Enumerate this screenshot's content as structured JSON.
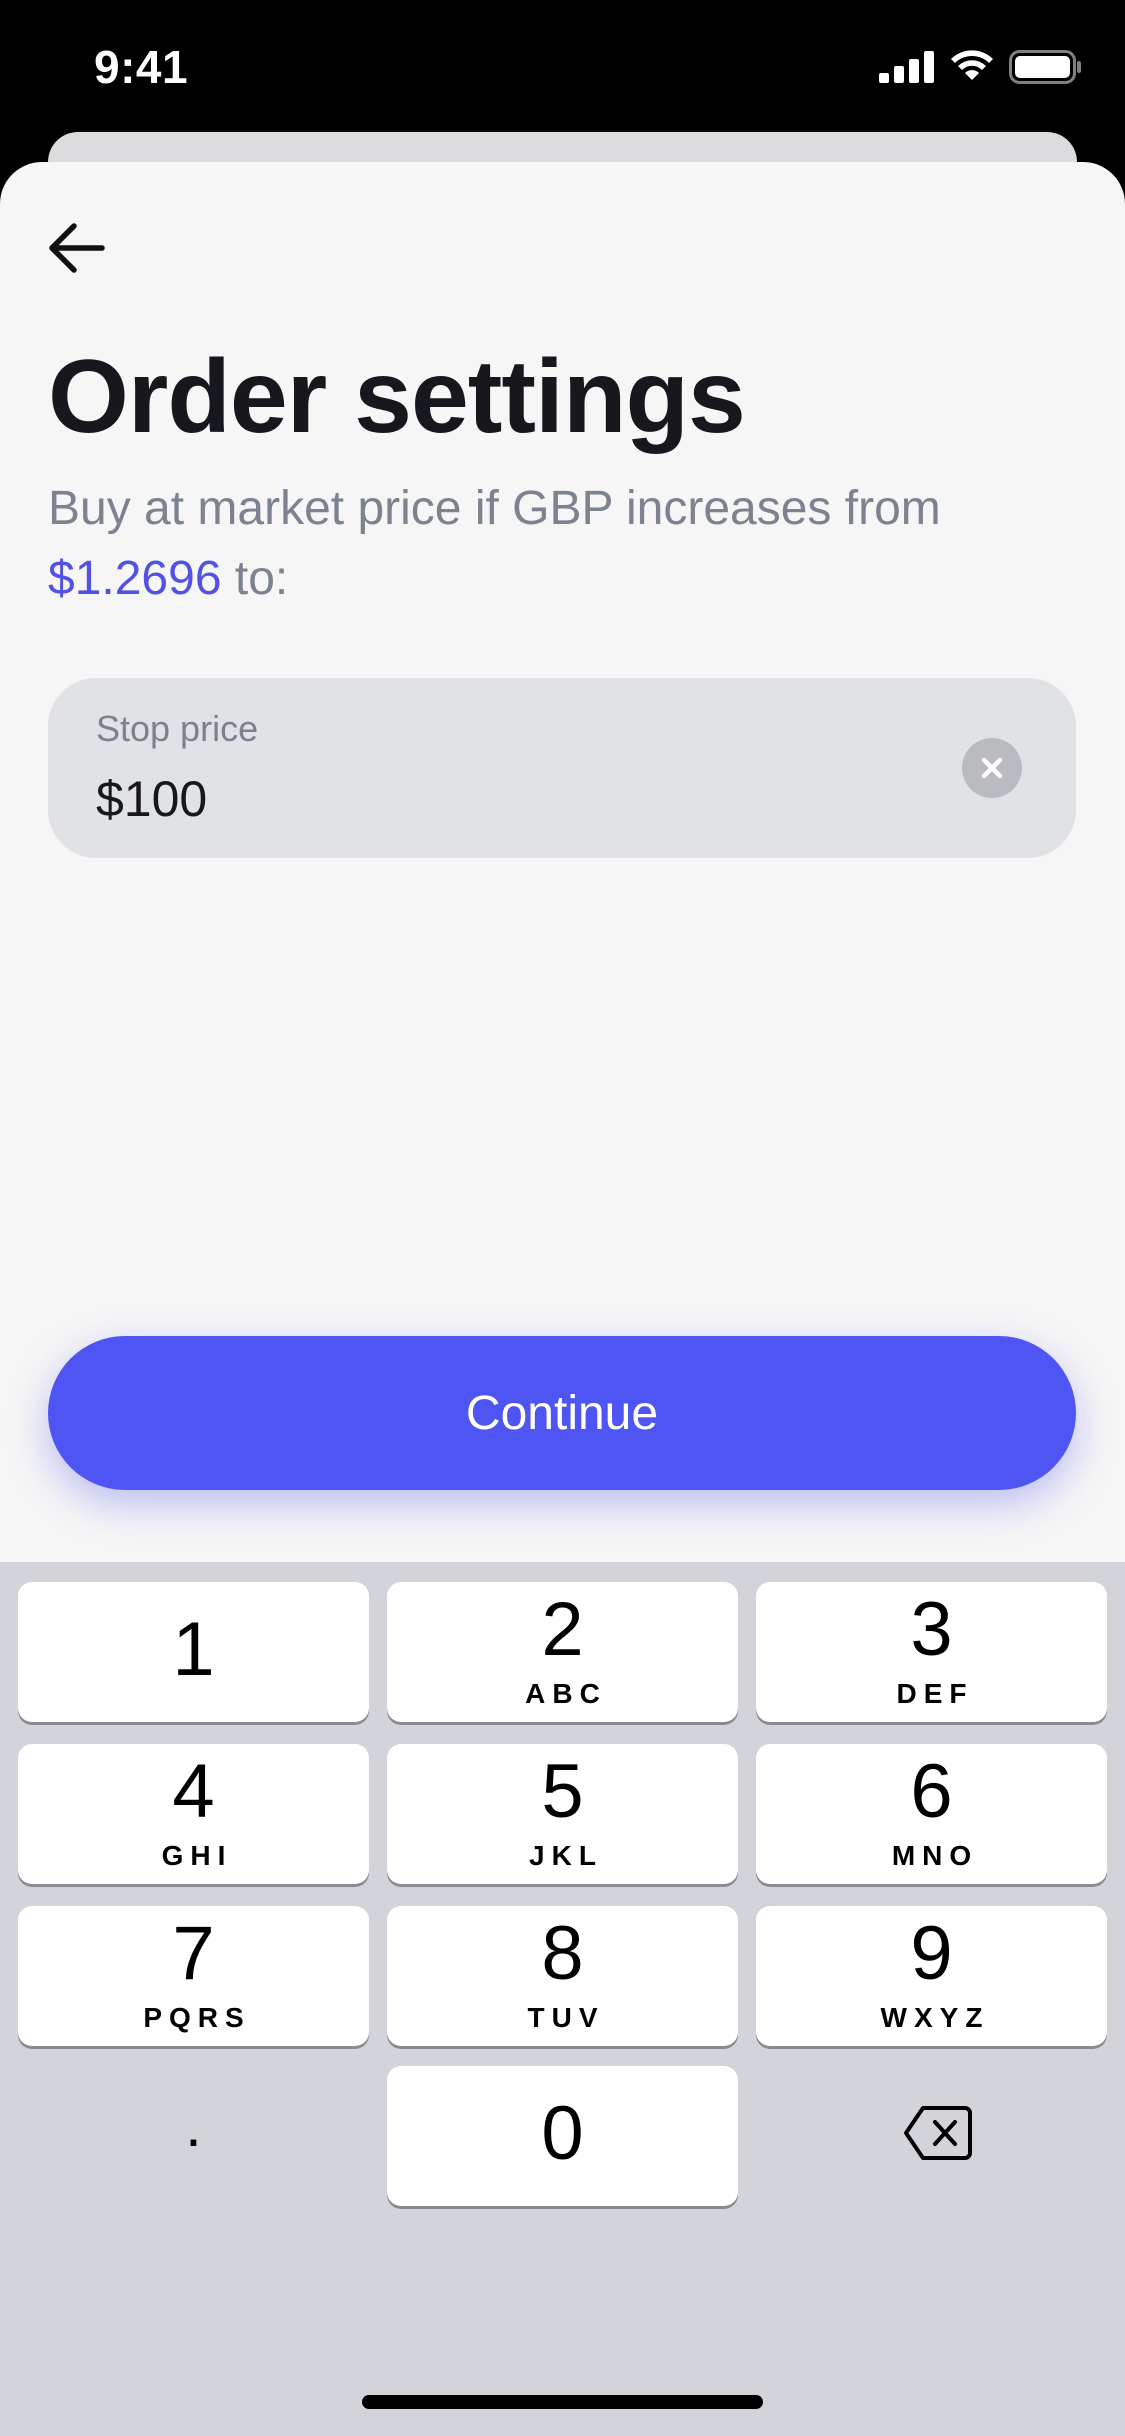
{
  "status_bar": {
    "time": "9:41"
  },
  "header": {
    "title": "Order settings",
    "subtitle_prefix": "Buy at market price if GBP increases from",
    "subtitle_price": "$1.2696",
    "subtitle_suffix": "to:"
  },
  "stop_field": {
    "label": "Stop price",
    "value": "$100"
  },
  "continue_button": {
    "label": "Continue"
  },
  "keypad": {
    "keys": [
      {
        "digit": "1",
        "letters": ""
      },
      {
        "digit": "2",
        "letters": "ABC"
      },
      {
        "digit": "3",
        "letters": "DEF"
      },
      {
        "digit": "4",
        "letters": "GHI"
      },
      {
        "digit": "5",
        "letters": "JKL"
      },
      {
        "digit": "6",
        "letters": "MNO"
      },
      {
        "digit": "7",
        "letters": "PQRS"
      },
      {
        "digit": "8",
        "letters": "TUV"
      },
      {
        "digit": "9",
        "letters": "WXYZ"
      },
      {
        "digit": "0",
        "letters": ""
      }
    ],
    "decimal": "."
  },
  "colors": {
    "accent": "#4E55F2",
    "price_text": "#5151E6",
    "sheet_bg": "#F6F6F6",
    "keypad_bg": "#D2D4DA"
  },
  "icons": [
    "back-arrow-icon",
    "clear-icon",
    "backspace-icon",
    "signal-icon",
    "wifi-icon",
    "battery-icon"
  ]
}
